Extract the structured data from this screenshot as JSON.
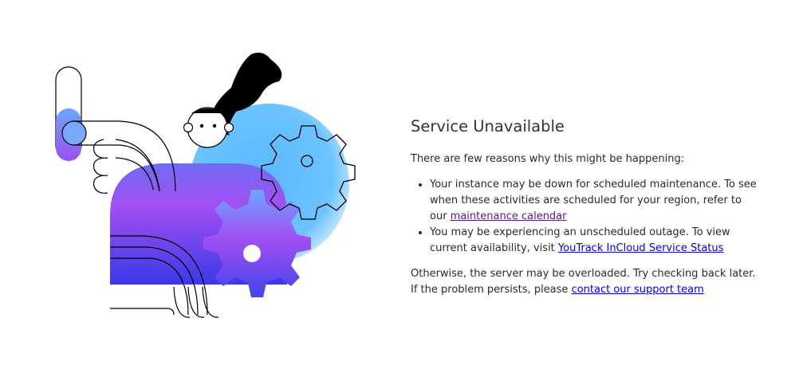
{
  "page": {
    "title": "Service Unavailable",
    "intro": "There are few reasons why this might be happening:",
    "reasons": [
      {
        "text": "Your instance may be down for scheduled maintenance. To see when these activities are scheduled for your region, refer to our ",
        "link_text": "maintenance calendar"
      },
      {
        "text": "You may be experiencing an unscheduled outage. To view current availability, visit ",
        "link_text": "YouTrack InCloud Service Status"
      }
    ],
    "closing_text": "Otherwise, the server may be overloaded. Try checking back later. If the problem persists, please ",
    "closing_link_text": "contact our support team"
  },
  "colors": {
    "text": "#2a2a2a",
    "title": "#333333",
    "link": "#0000ee",
    "visited_link": "#551a8b",
    "circle_blue": "#6cc4ff",
    "gradient_purple": "#a24ff2",
    "gradient_blue": "#3a39e8",
    "hair": "#000000"
  },
  "illustration": {
    "icons": [
      "person-head-icon",
      "gear-outline-icon",
      "gear-filled-icon",
      "hand-lever-icon",
      "hair-icon"
    ]
  }
}
